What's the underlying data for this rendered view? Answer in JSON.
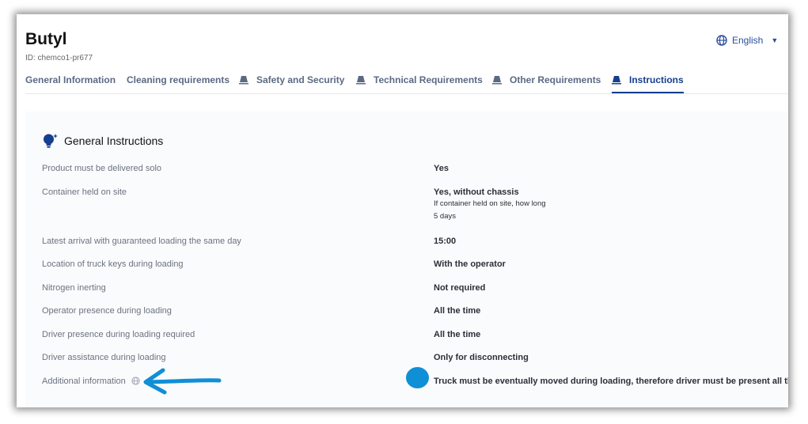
{
  "header": {
    "title": "Butyl",
    "product_id": "ID: chemco1-pr677",
    "language": "English"
  },
  "tabs": [
    {
      "label": "General Information",
      "icon": "none",
      "active": false
    },
    {
      "label": "Cleaning requirements",
      "icon": "none",
      "active": false
    },
    {
      "label": "Safety and Security",
      "icon": "tank-truck-icon",
      "active": false
    },
    {
      "label": "Technical Requirements",
      "icon": "tank-truck-icon",
      "active": false
    },
    {
      "label": "Other Requirements",
      "icon": "tank-truck-icon",
      "active": false
    },
    {
      "label": "Instructions",
      "icon": "tank-truck-icon",
      "active": true
    }
  ],
  "section": {
    "title": "General Instructions",
    "icon": "lightbulb-sparkle-icon"
  },
  "rows": [
    {
      "label": "Product must be delivered solo",
      "value": "Yes"
    },
    {
      "label": "Container held on site",
      "value": "Yes, without chassis",
      "sub_label": "If container held on site, how long",
      "sub_value": "5 days"
    },
    {
      "label": "Latest arrival with guaranteed loading the same day",
      "value": "15:00"
    },
    {
      "label": "Location of truck keys during loading",
      "value": "With the operator"
    },
    {
      "label": "Nitrogen inerting",
      "value": "Not required"
    },
    {
      "label": "Operator presence during loading",
      "value": "All the time"
    },
    {
      "label": "Driver presence during loading required",
      "value": "All the time"
    },
    {
      "label": "Driver assistance during loading",
      "value": "Only for disconnecting"
    },
    {
      "label": "Additional information",
      "value": "Truck must be eventually moved during loading, therefore driver must be present all the time"
    }
  ],
  "colors": {
    "accent": "#153f8f",
    "annotation": "#0f8fd6"
  }
}
